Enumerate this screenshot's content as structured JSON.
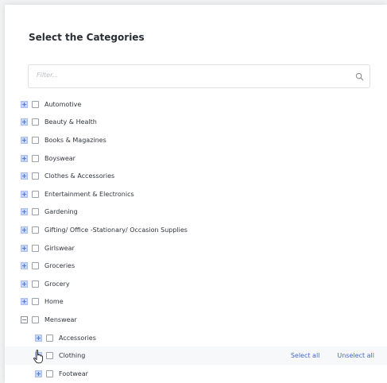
{
  "dialog": {
    "title": "Select the Categories",
    "filter_placeholder": "Filter..."
  },
  "categories": [
    {
      "label": "Automotive",
      "state": "collapsed"
    },
    {
      "label": "Beauty & Health",
      "state": "collapsed"
    },
    {
      "label": "Books & Magazines",
      "state": "collapsed"
    },
    {
      "label": "Boyswear",
      "state": "collapsed"
    },
    {
      "label": "Clothes & Accessories",
      "state": "collapsed"
    },
    {
      "label": "Entertainment & Electronics",
      "state": "collapsed"
    },
    {
      "label": "Gardening",
      "state": "collapsed"
    },
    {
      "label": "Gifting/ Office -Stationary/ Occasion Supplies",
      "state": "collapsed"
    },
    {
      "label": "Girlswear",
      "state": "collapsed"
    },
    {
      "label": "Groceries",
      "state": "collapsed"
    },
    {
      "label": "Grocery",
      "state": "collapsed"
    },
    {
      "label": "Home",
      "state": "collapsed"
    },
    {
      "label": "Menswear",
      "state": "expanded",
      "children": [
        {
          "label": "Accessories",
          "state": "collapsed"
        },
        {
          "label": "Clothing",
          "state": "collapsed"
        },
        {
          "label": "Footwear",
          "state": "collapsed"
        }
      ]
    }
  ],
  "row_actions": {
    "select_all": "Select all",
    "unselect_all": "Unselect all"
  },
  "icons": {
    "expand": "plus-square-icon",
    "collapse": "minus-square-icon",
    "search": "search-icon",
    "cursor": "hand-pointer-icon"
  },
  "colors": {
    "link": "#4468c4",
    "expander_fill": "#c5d5f4",
    "title": "#2a2f36"
  }
}
